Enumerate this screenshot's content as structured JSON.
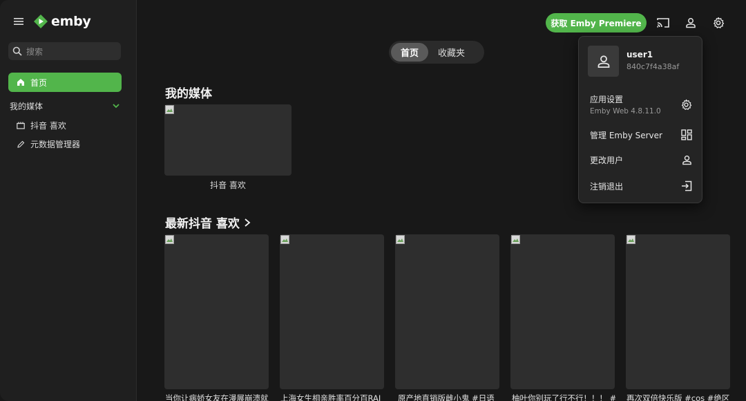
{
  "app": {
    "name": "emby"
  },
  "sidebar": {
    "search_placeholder": "搜索",
    "home_label": "首页",
    "section_label": "我的媒体",
    "items": [
      {
        "label": "抖音 喜欢",
        "icon": "movie-icon"
      },
      {
        "label": "元数据管理器",
        "icon": "pencil-icon"
      }
    ]
  },
  "header": {
    "premiere_label": "获取 Emby Premiere",
    "icons": [
      "cast-icon",
      "user-icon",
      "gear-icon"
    ]
  },
  "tabs": [
    {
      "label": "首页",
      "active": true
    },
    {
      "label": "收藏夹",
      "active": false
    }
  ],
  "my_media": {
    "title": "我的媒体",
    "items": [
      {
        "label": "抖音 喜欢"
      }
    ]
  },
  "latest": {
    "title": "最新抖音 喜欢",
    "items": [
      {
        "title": "当你让病娇女友在漫展崩溃就"
      },
      {
        "title": "上海女生相亲胜率百分百RAI"
      },
      {
        "title": "原产地直销版雌小鬼 #日语"
      },
      {
        "title": "柚叶你别玩了行不行！！！ #"
      },
      {
        "title": "再次双倍快乐版 #cos #绝区"
      }
    ]
  },
  "user_menu": {
    "username": "user1",
    "user_id": "840c7f4a38af",
    "items": [
      {
        "label": "应用设置",
        "sublabel": "Emby Web 4.8.11.0",
        "icon": "gear-icon"
      },
      {
        "label": "管理 Emby Server",
        "icon": "dashboard-icon"
      },
      {
        "label": "更改用户",
        "icon": "user-icon"
      },
      {
        "label": "注销退出",
        "icon": "logout-icon"
      }
    ]
  },
  "colors": {
    "accent": "#52b54b",
    "background": "#181818",
    "sidebar": "#1f1f1f",
    "card": "#2e2e2e"
  }
}
